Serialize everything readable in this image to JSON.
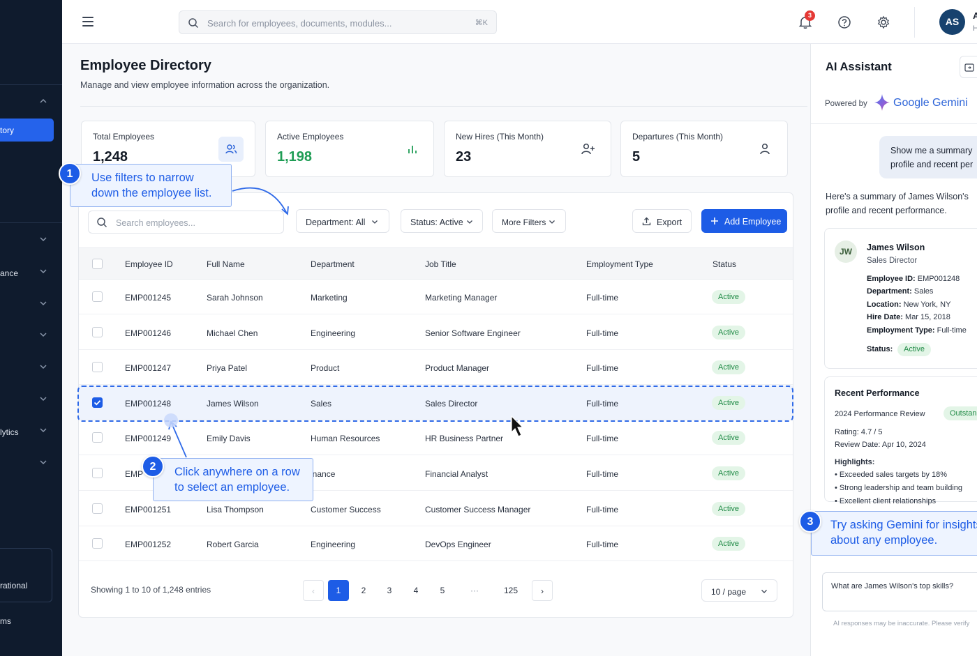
{
  "sidebar": {
    "items": [
      {
        "label": "tory",
        "active": true
      },
      {
        "label": ""
      },
      {
        "label": "ance"
      },
      {
        "label": ""
      },
      {
        "label": ""
      },
      {
        "label": ""
      },
      {
        "label": ""
      },
      {
        "label": "lytics"
      },
      {
        "label": ""
      }
    ],
    "bottom_box_label": "rational",
    "last_label": "ms"
  },
  "topbar": {
    "search_placeholder": "Search for employees, documents, modules...",
    "search_shortcut": "⌘K",
    "notification_count": "3",
    "avatar_initials": "AS",
    "user_name_fragment": "A",
    "user_sub_fragment": "H"
  },
  "page": {
    "title": "Employee Directory",
    "subtitle": "Manage and view employee information across the organization."
  },
  "stats": [
    {
      "label": "Total Employees",
      "value": "1,248",
      "icon": "users-icon"
    },
    {
      "label": "Active Employees",
      "value": "1,198",
      "icon": "bar-chart-icon"
    },
    {
      "label": "New Hires (This Month)",
      "value": "23",
      "icon": "user-plus-icon"
    },
    {
      "label": "Departures (This Month)",
      "value": "5",
      "icon": "user-icon"
    }
  ],
  "toolbar": {
    "search_placeholder": "Search employees...",
    "department_filter": "Department: All",
    "status_filter": "Status: Active",
    "more_filters": "More Filters",
    "export_label": "Export",
    "add_label": "Add Employee"
  },
  "table": {
    "columns": [
      "Employee ID",
      "Full Name",
      "Department",
      "Job Title",
      "Employment Type",
      "Status"
    ],
    "rows": [
      {
        "id": "EMP001245",
        "name": "Sarah Johnson",
        "dept": "Marketing",
        "title": "Marketing Manager",
        "type": "Full-time",
        "status": "Active",
        "selected": false
      },
      {
        "id": "EMP001246",
        "name": "Michael Chen",
        "dept": "Engineering",
        "title": "Senior Software Engineer",
        "type": "Full-time",
        "status": "Active",
        "selected": false
      },
      {
        "id": "EMP001247",
        "name": "Priya Patel",
        "dept": "Product",
        "title": "Product Manager",
        "type": "Full-time",
        "status": "Active",
        "selected": false
      },
      {
        "id": "EMP001248",
        "name": "James Wilson",
        "dept": "Sales",
        "title": "Sales Director",
        "type": "Full-time",
        "status": "Active",
        "selected": true
      },
      {
        "id": "EMP001249",
        "name": "Emily Davis",
        "dept": "Human Resources",
        "title": "HR Business Partner",
        "type": "Full-time",
        "status": "Active",
        "selected": false
      },
      {
        "id": "EMP",
        "name": "",
        "dept": "inance",
        "title": "Financial Analyst",
        "type": "Full-time",
        "status": "Active",
        "selected": false
      },
      {
        "id": "EMP001251",
        "name": "Lisa Thompson",
        "dept": "Customer Success",
        "title": "Customer Success Manager",
        "type": "Full-time",
        "status": "Active",
        "selected": false
      },
      {
        "id": "EMP001252",
        "name": "Robert Garcia",
        "dept": "Engineering",
        "title": "DevOps Engineer",
        "type": "Full-time",
        "status": "Active",
        "selected": false
      }
    ]
  },
  "pagination": {
    "summary": "Showing 1 to 10 of 1,248 entries",
    "pages": [
      "1",
      "2",
      "3",
      "4",
      "5",
      "···",
      "125"
    ],
    "current": "1",
    "prev": "‹",
    "next": "›",
    "per_page": "10 / page"
  },
  "callouts": {
    "one": {
      "num": "1",
      "text": "Use filters to narrow down the employee list."
    },
    "two": {
      "num": "2",
      "text": "Click anywhere on a row to select an employee."
    },
    "three": {
      "num": "3",
      "text": "Try asking Gemini for insights about any employee."
    }
  },
  "ai": {
    "title": "AI Assistant",
    "powered_by": "Powered by",
    "brand": "Google Gemini",
    "user_message": "Show me a summary profile and recent per",
    "reply": "Here's a summary of James Wilson's profile and recent performance.",
    "profile": {
      "initials": "JW",
      "name": "James Wilson",
      "role": "Sales Director",
      "fields": [
        {
          "k": "Employee ID:",
          "v": "EMP001248"
        },
        {
          "k": "Department:",
          "v": "Sales"
        },
        {
          "k": "Location:",
          "v": "New York, NY"
        },
        {
          "k": "Hire Date:",
          "v": "Mar 15, 2018"
        },
        {
          "k": "Employment Type:",
          "v": "Full-time"
        }
      ],
      "status_label": "Status:",
      "status_value": "Active"
    },
    "performance": {
      "title": "Recent Performance",
      "review": "2024 Performance Review",
      "badge": "Outstand",
      "rating": "Rating:  4.7 / 5",
      "review_date": "Review Date:  Apr 10, 2024",
      "highlights_label": "Highlights:",
      "highlights": [
        "Exceeded sales targets by 18%",
        "Strong leadership and team building",
        "Excellent client relationships"
      ]
    },
    "input_value": "What are James Wilson's top skills?",
    "disclaimer": "AI responses may be inaccurate. Please verify"
  },
  "colors": {
    "accent": "#1d5ce6",
    "sidebar": "#0f1b2d",
    "active_green": "#1f9d55"
  }
}
